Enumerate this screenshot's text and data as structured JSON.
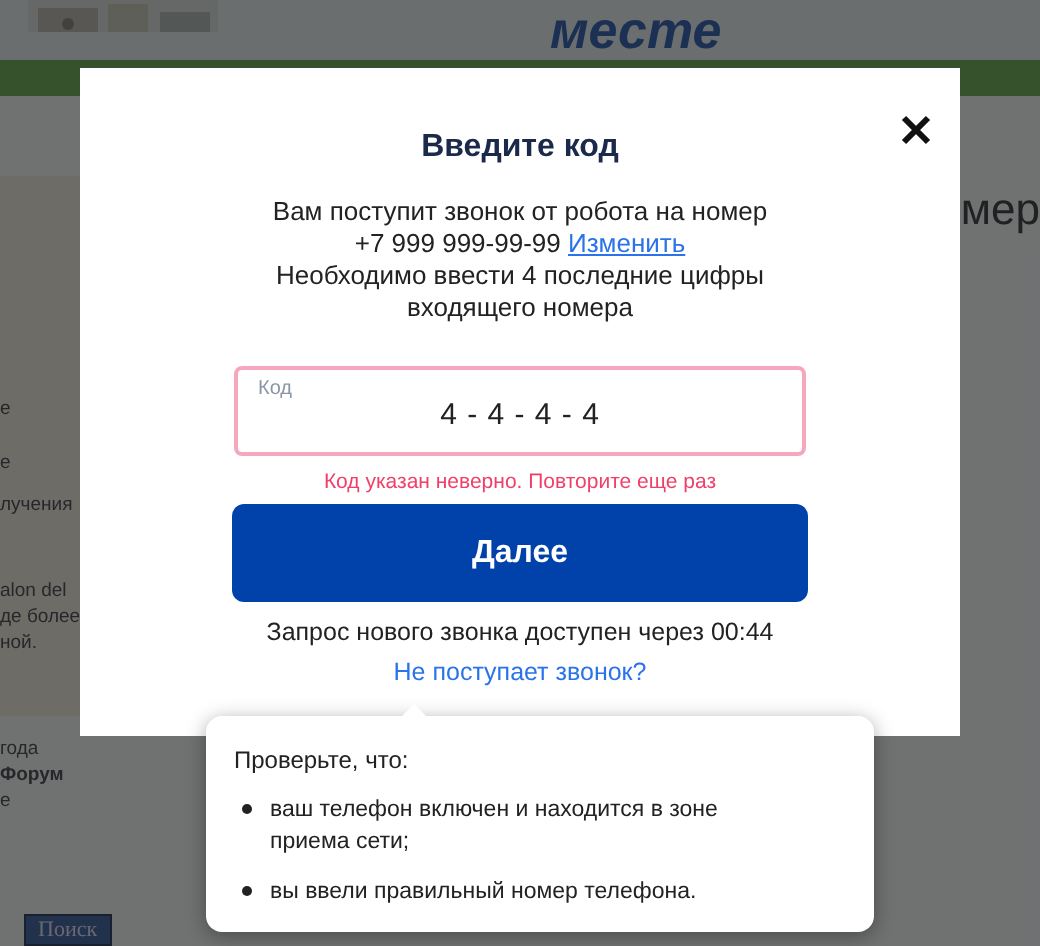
{
  "background_page": {
    "heading": "месте",
    "side_texts": [
      "е",
      "е",
      "лучения",
      "alon del",
      "де более",
      "ной.",
      "года",
      "Форум",
      "е"
    ],
    "right_text": "мер",
    "search_button": "Поиск"
  },
  "dialog": {
    "title": "Введите код",
    "message_before": "Вам поступит звонок от робота на номер",
    "phone": "+7 999 999-99-99",
    "change_link": "Изменить",
    "message_after": "Необходимо ввести 4 последние цифры входящего номера",
    "code_field": {
      "label": "Код",
      "value": "4 - 4 - 4 - 4",
      "invalid": true
    },
    "error": "Код указан неверно. Повторите еще раз",
    "submit_button": "Далее",
    "timer_text": "Запрос нового звонка доступен через 00:44",
    "help_link": "Не поступает звонок?"
  },
  "tooltip": {
    "title": "Проверьте, что:",
    "items": [
      "ваш телефон включен и находится в зоне приема сети;",
      "вы ввели правильный номер телефона."
    ]
  }
}
